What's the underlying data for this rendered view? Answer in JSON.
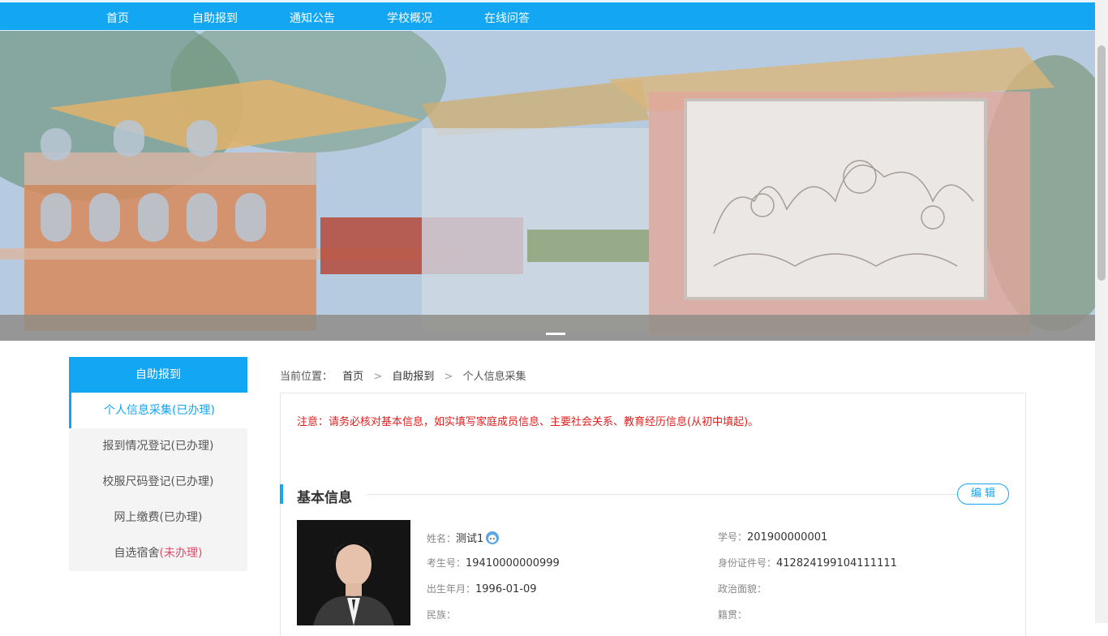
{
  "nav": {
    "items": [
      "首页",
      "自助报到",
      "通知公告",
      "学校概况",
      "在线问答"
    ]
  },
  "colors": {
    "accent": "#12a6f3",
    "notice": "#e51c1c",
    "pending": "#e04b6b"
  },
  "sidebar": {
    "title": "自助报到",
    "items": [
      {
        "label": "个人信息采集",
        "status": "(已办理)"
      },
      {
        "label": "报到情况登记",
        "status": "(已办理)"
      },
      {
        "label": "校服尺码登记",
        "status": "(已办理)"
      },
      {
        "label": "网上缴费",
        "status": "(已办理)"
      },
      {
        "label": "自选宿舍",
        "status": "(未办理)"
      }
    ]
  },
  "breadcrumb": {
    "prefix": "当前位置：",
    "items": [
      "首页",
      "自助报到",
      "个人信息采集"
    ],
    "separator": ">"
  },
  "notice": "注意：请务必核对基本信息，如实填写家庭成员信息、主要社会关系、教育经历信息(从初中填起)。",
  "section": {
    "title": "基本信息",
    "edit_label": "编 辑"
  },
  "profile": {
    "name_label": "姓名：",
    "name": "测试1",
    "student_no_label": "学号：",
    "student_no": "201900000001",
    "exam_no_label": "考生号：",
    "exam_no": "19410000000999",
    "id_no_label": "身份证件号：",
    "id_no": "412824199104111111",
    "birth_label": "出生年月：",
    "birth": "1996-01-09",
    "political_label": "政治面貌：",
    "political": "",
    "ethnic_label": "民族：",
    "ethnic": "",
    "native_label": "籍贯：",
    "native": ""
  }
}
